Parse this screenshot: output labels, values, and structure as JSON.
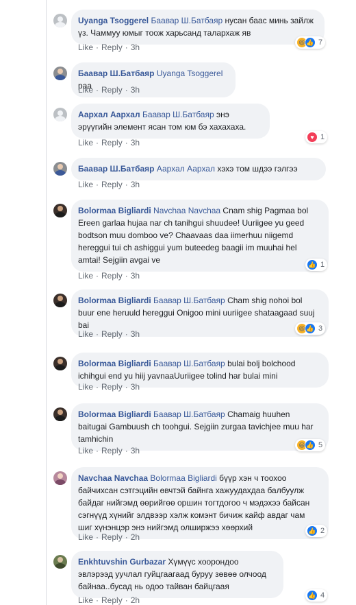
{
  "actions": {
    "like": "Like",
    "reply": "Reply",
    "sep": "·"
  },
  "comments": [
    {
      "author": "Uyanga Tsoggerel",
      "mention": "Баавар Ш.Батбаяр",
      "text": " нусан баас минь зайлж үз. Чаммуу юмыг тоож харьсанд талархаж яв",
      "time": "3h",
      "reactions": [
        "haha",
        "like"
      ],
      "count": "7"
    },
    {
      "author": "Баавар Ш.Батбаяр",
      "mention": "Uyanga Tsoggerel",
      "text": " раа",
      "time": "3h",
      "reactions": [],
      "count": ""
    },
    {
      "author": "Аархал Аархал",
      "mention": "Баавар Ш.Батбаяр",
      "text": " энэ эрүүгийн элемент ясан том юм бэ хахахаха.",
      "time": "3h",
      "reactions": [
        "love"
      ],
      "count": "1"
    },
    {
      "author": "Баавар Ш.Батбаяр",
      "mention": "Аархал Аархал",
      "text": " хэхэ том шдээ гэлгээ",
      "time": "3h",
      "reactions": [],
      "count": ""
    },
    {
      "author": "Bolormaa Bigliardi",
      "mention": "Navchaa Navchaa",
      "text": " Cnam shig Pagmaa bol Ereen garlaa hujaa nar ch tanihgui shuudee! Uuriigee yu geed bodtson muu domboo ve? Chaavaas daa iimerhuu niigemd hereggui tui ch ashiggui yum buteedeg baagii im muuhai hel amtai! Sejgiin avgai ve",
      "time": "3h",
      "reactions": [
        "like"
      ],
      "count": "1"
    },
    {
      "author": "Bolormaa Bigliardi",
      "mention": "Баавар Ш.Батбаяр",
      "text": " Cham shig nohoi bol buur ene heruuld hereggui Onigoo mini uuriigee shataagaad suuj bai",
      "time": "3h",
      "reactions": [
        "haha",
        "like"
      ],
      "count": "3"
    },
    {
      "author": "Bolormaa Bigliardi",
      "mention": "Баавар Ш.Батбаяр",
      "text": " bulai bolj bolchood ichihgui end yu hiij yavnaaUuriigee tolind har bulai mini",
      "time": "3h",
      "reactions": [],
      "count": ""
    },
    {
      "author": "Bolormaa Bigliardi",
      "mention": "Баавар Ш.Батбаяр",
      "text": " Chamaig huuhen baitugai Gambuush ch toohgui. Sejgiin zurgaa tavichjee muu har tamhichin",
      "time": "3h",
      "reactions": [
        "haha",
        "like"
      ],
      "count": "5"
    },
    {
      "author": "Navchaa Navchaa",
      "mention": "Bolormaa Bigliardi",
      "text": " бүүр хэн ч тоохоо байчихсан сэтгэцийн өвчтэй байнга хажуудахдаа балбуулж байдаг нийгэмд өөрийгөө оршин тогтдогоо ч мэдэхээ байсан сэгнүүд хүнийг элдвээр хэлж комэнт бичиж кайф авдаг чам шиг хүнэнцэр энэ нийгэмд олширжээ хөөрхий",
      "time": "2h",
      "reactions": [
        "like"
      ],
      "count": "2"
    },
    {
      "author": "Enkhtuvshin Gurbazar",
      "mention": "",
      "text": "Хүмүүс хоорондоо эвлэрээд уучлал гуйцгаагаад буруу зөвөө олчоод байнаа..бусад нь одоо тайван байцгаая",
      "time": "2h",
      "reactions": [
        "like"
      ],
      "count": "4"
    }
  ]
}
